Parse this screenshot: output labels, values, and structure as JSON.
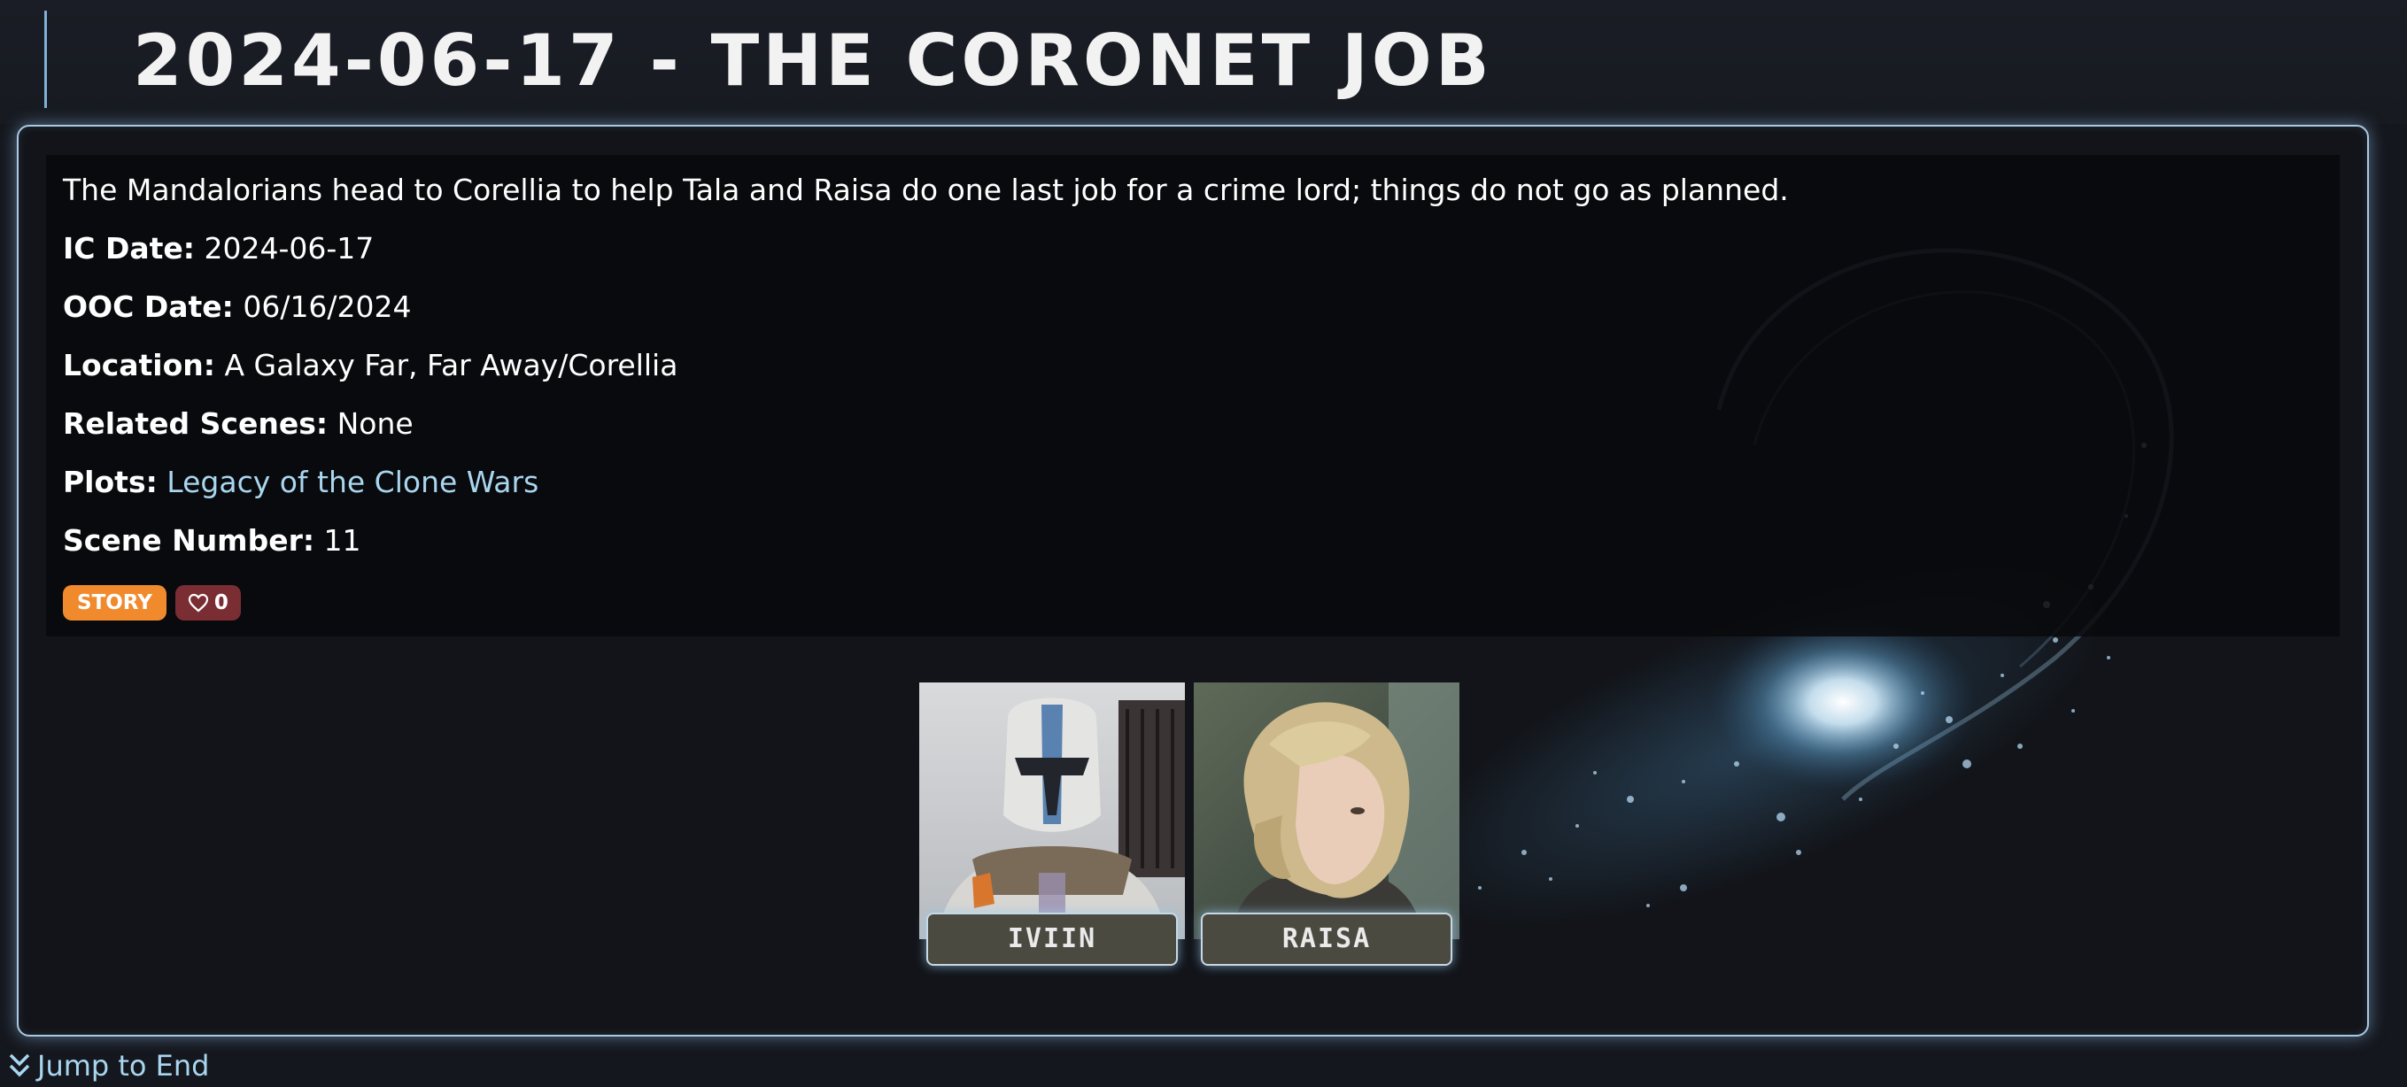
{
  "header": {
    "title": "2024-06-17 - The Coronet Job"
  },
  "scene": {
    "summary": "The Mandalorians head to Corellia to help Tala and Raisa do one last job for a crime lord; things do not go as planned.",
    "fields": [
      {
        "label": "IC Date:",
        "value": "2024-06-17"
      },
      {
        "label": "OOC Date:",
        "value": "06/16/2024"
      },
      {
        "label": "Location:",
        "value": "A Galaxy Far, Far Away/Corellia"
      },
      {
        "label": "Related Scenes:",
        "value": "None"
      },
      {
        "label": "Plots:",
        "value": "Legacy of the Clone Wars"
      },
      {
        "label": "Scene Number:",
        "value": "11"
      }
    ],
    "tags": {
      "story_label": "STORY",
      "like_count": "0"
    },
    "characters": [
      {
        "name": "IVIIN"
      },
      {
        "name": "RAISA"
      }
    ]
  },
  "footer": {
    "jump_label": "Jump to End"
  },
  "colors": {
    "accent_link": "#a9d6ef",
    "story_tag": "#f08a2c",
    "like_tag": "#7a2d33",
    "panel_glow": "#aac9e2"
  }
}
